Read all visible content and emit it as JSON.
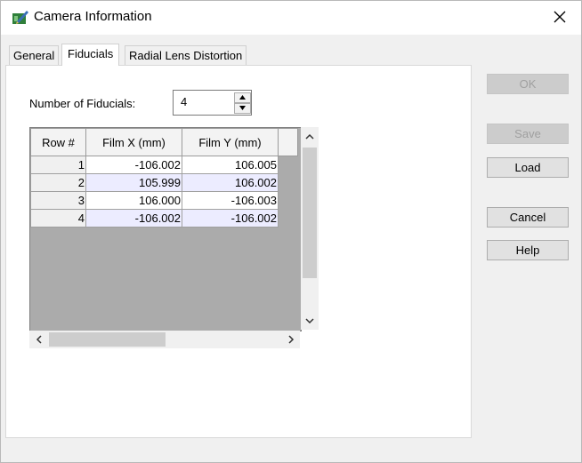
{
  "window": {
    "title": "Camera Information"
  },
  "tabs": [
    {
      "label": "General",
      "active": false
    },
    {
      "label": "Fiducials",
      "active": true
    },
    {
      "label": "Radial Lens Distortion",
      "active": false
    }
  ],
  "fiducials": {
    "count_label": "Number of Fiducials:",
    "count_value": "4",
    "columns": [
      "Row #",
      "Film X (mm)",
      "Film Y (mm)"
    ],
    "rows": [
      {
        "row": "1",
        "x": "-106.002",
        "y": "106.005"
      },
      {
        "row": "2",
        "x": "105.999",
        "y": "106.002"
      },
      {
        "row": "3",
        "x": "106.000",
        "y": "-106.003"
      },
      {
        "row": "4",
        "x": "-106.002",
        "y": "-106.002"
      }
    ]
  },
  "buttons": {
    "ok": {
      "label": "OK",
      "enabled": false
    },
    "save": {
      "label": "Save",
      "enabled": false
    },
    "load": {
      "label": "Load",
      "enabled": true
    },
    "cancel": {
      "label": "Cancel",
      "enabled": true
    },
    "help": {
      "label": "Help",
      "enabled": true
    }
  },
  "icons": {
    "app": "camera-pen-icon",
    "close": "close-icon"
  }
}
